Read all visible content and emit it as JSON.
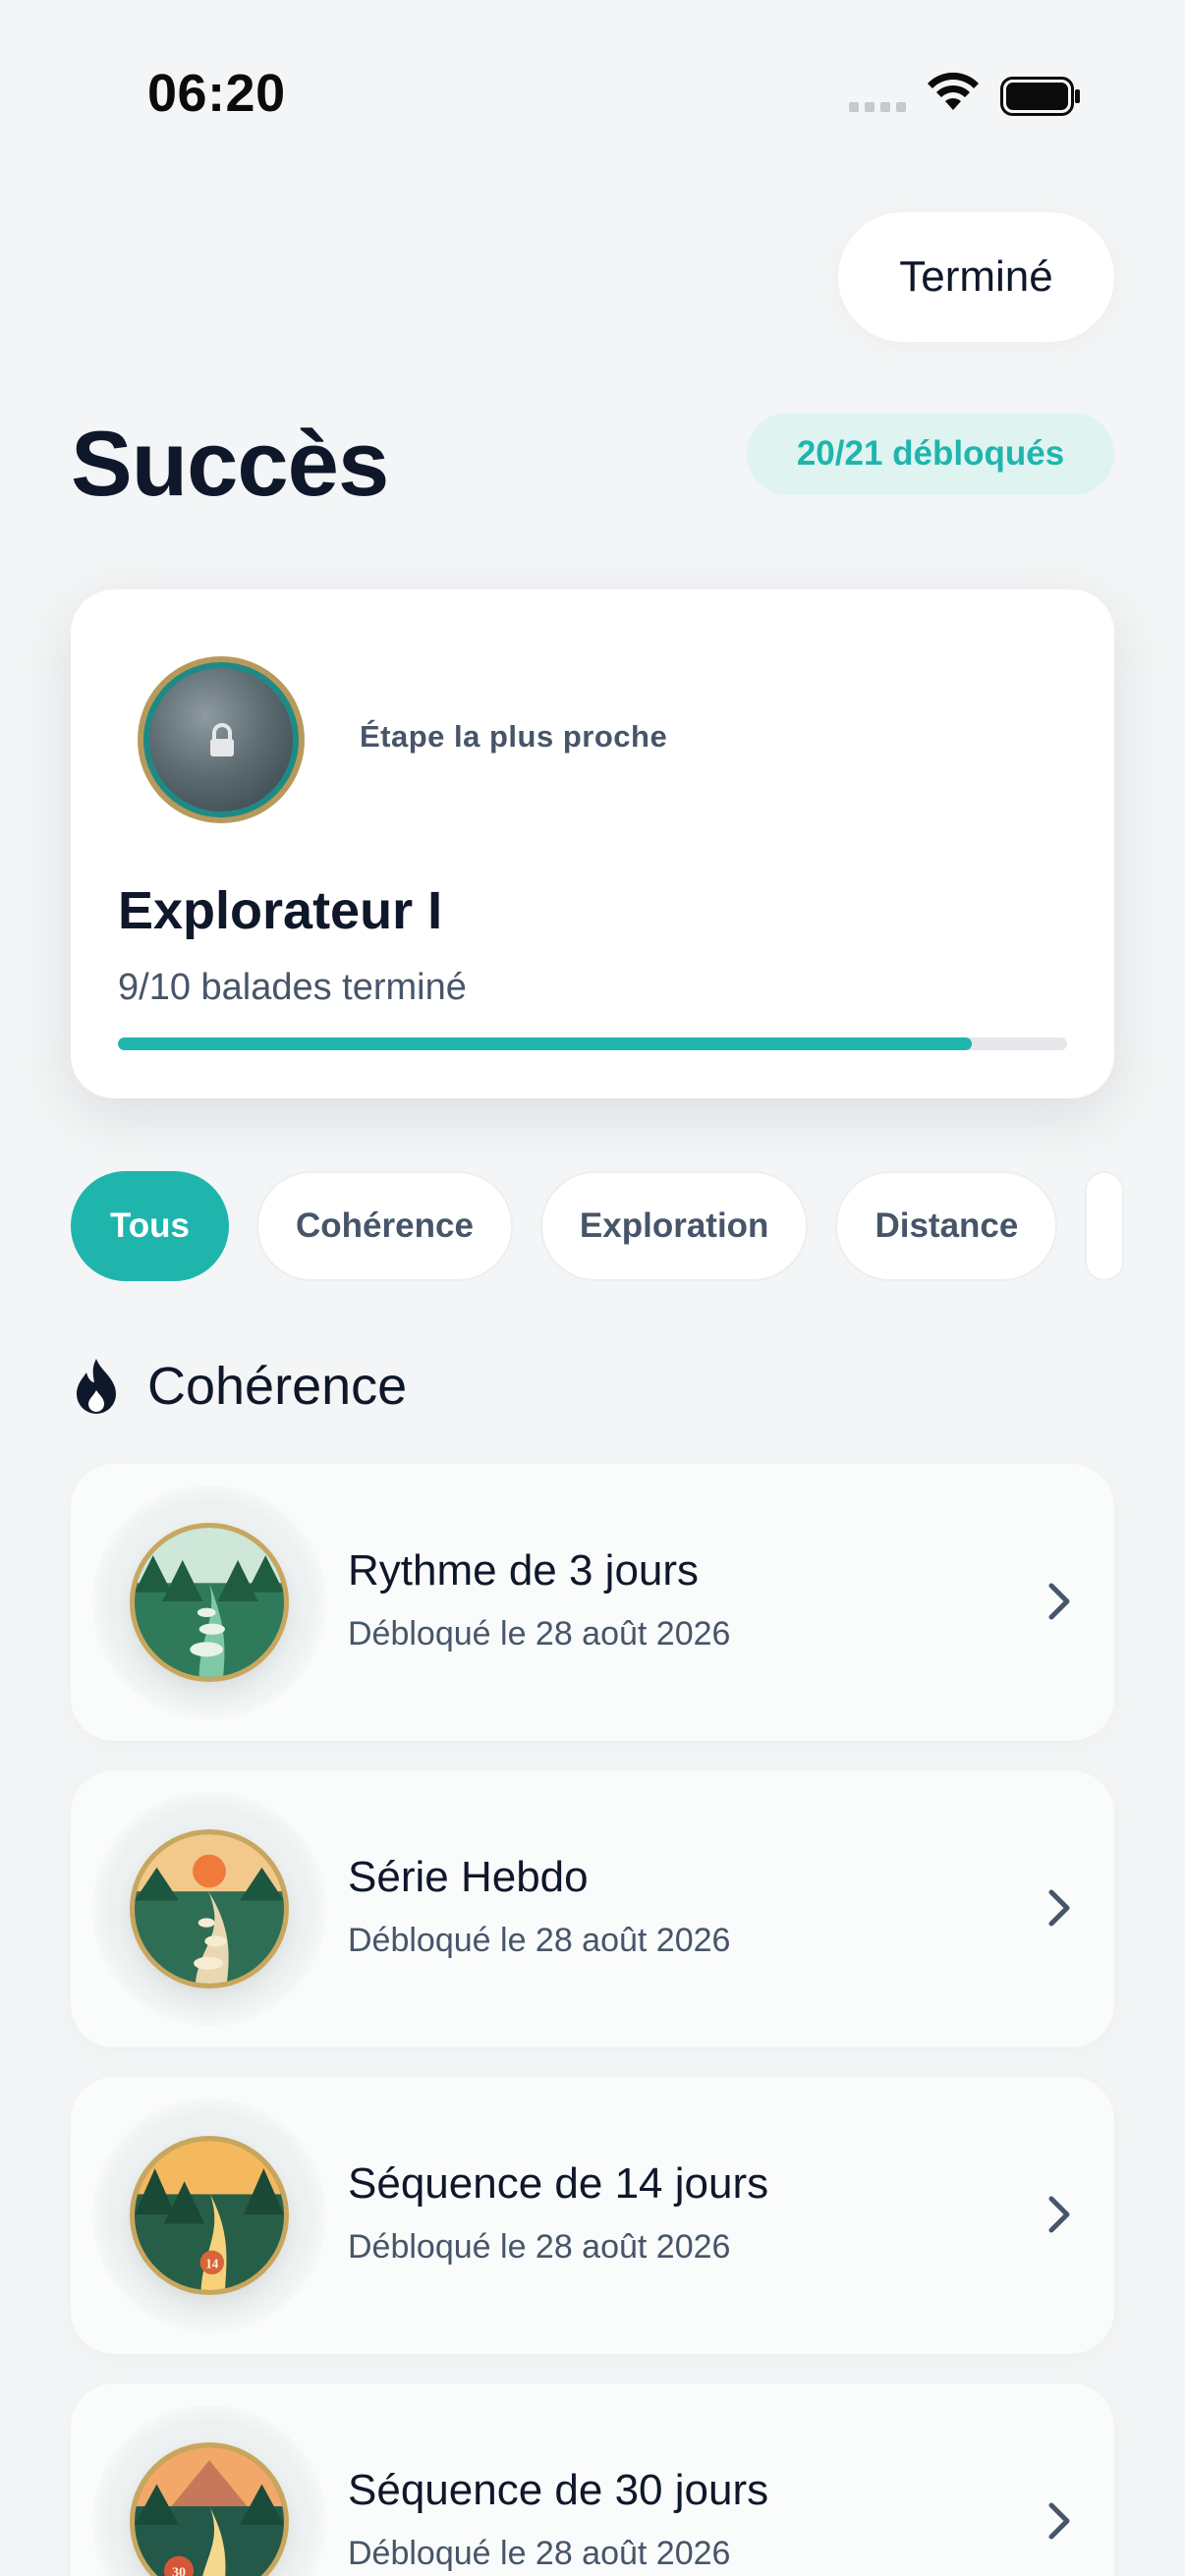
{
  "status_bar": {
    "time": "06:20"
  },
  "header": {
    "done_label": "Terminé"
  },
  "page": {
    "title": "Succès",
    "unlocked_badge": "20/21 débloqués"
  },
  "milestone": {
    "kicker": "Étape la plus proche",
    "title": "Explorateur I",
    "progress_text": "9/10 balades terminé",
    "progress": 0.9,
    "medal_icon": "lock-icon"
  },
  "filters": [
    "Tous",
    "Cohérence",
    "Exploration",
    "Distance"
  ],
  "active_filter": "Tous",
  "section": {
    "title": "Cohérence",
    "icon": "flame-icon"
  },
  "achievements": [
    {
      "title": "Rythme de 3 jours",
      "subtitle": "Débloqué le 28 août 2026"
    },
    {
      "title": "Série Hebdo",
      "subtitle": "Débloqué le 28 août 2026"
    },
    {
      "title": "Séquence de 14 jours",
      "subtitle": "Débloqué le 28 août 2026",
      "medal_number": "14"
    },
    {
      "title": "Séquence de 30 jours",
      "subtitle": "Débloqué le 28 août 2026",
      "medal_number": "30"
    }
  ],
  "colors": {
    "accent": "#1fb5ad",
    "accent_soft": "#dff4f1",
    "text_primary": "#0f172a",
    "text_secondary": "#475569"
  }
}
